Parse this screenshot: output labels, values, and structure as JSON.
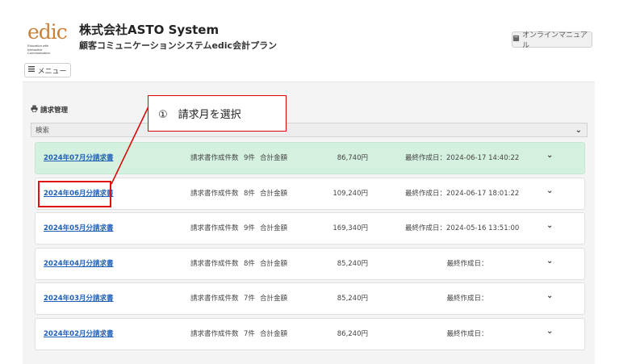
{
  "header": {
    "logo_word": "edic",
    "logo_sub": "Education with\nInteractive\nCommunication",
    "company": "株式会社ASTO System",
    "plan": "顧客コミュニケーションシステムedic会計プラン",
    "manual_button": "オンラインマニュアル",
    "menu_button": "メニュー"
  },
  "main": {
    "section_title": "請求管理",
    "search_label": "検索"
  },
  "invoices": [
    {
      "month": "2024年07月分請求書",
      "count_label": "請求書作成件数",
      "count": "9件",
      "total_label": "合計金額",
      "amount": "86,740円",
      "updated": "最終作成日：2024-06-17 14:40:22",
      "active": true
    },
    {
      "month": "2024年06月分請求書",
      "count_label": "請求書作成件数",
      "count": "8件",
      "total_label": "合計金額",
      "amount": "109,240円",
      "updated": "最終作成日：2024-06-17 18:01:22",
      "active": false
    },
    {
      "month": "2024年05月分請求書",
      "count_label": "請求書作成件数",
      "count": "9件",
      "total_label": "合計金額",
      "amount": "169,340円",
      "updated": "最終作成日：2024-05-16 13:51:00",
      "active": false
    },
    {
      "month": "2024年04月分請求書",
      "count_label": "請求書作成件数",
      "count": "8件",
      "total_label": "合計金額",
      "amount": "85,240円",
      "updated": "最終作成日：",
      "active": false
    },
    {
      "month": "2024年03月分請求書",
      "count_label": "請求書作成件数",
      "count": "7件",
      "total_label": "合計金額",
      "amount": "85,240円",
      "updated": "最終作成日：",
      "active": false
    },
    {
      "month": "2024年02月分請求書",
      "count_label": "請求書作成件数",
      "count": "7件",
      "total_label": "合計金額",
      "amount": "86,240円",
      "updated": "最終作成日：",
      "active": false
    }
  ],
  "annotation": {
    "callout_text": "①　請求月を選択",
    "color": "#dd0000"
  },
  "colors": {
    "active_row": "#d4f0df",
    "link": "#1f5fb8",
    "brand": "#c8823a"
  },
  "icons": {
    "manual": "book-icon",
    "menu": "hamburger-icon",
    "section": "printer-icon",
    "expand": "chevron-down-icon"
  }
}
